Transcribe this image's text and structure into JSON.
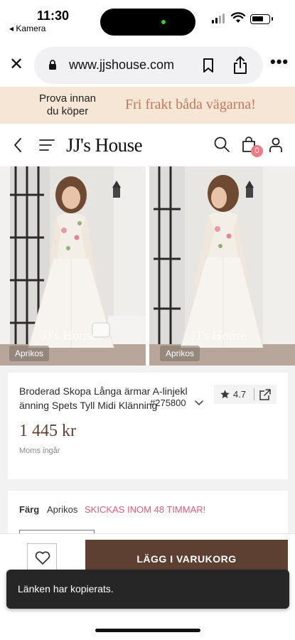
{
  "status_bar": {
    "time": "11:30",
    "back_app": "◂ Kamera"
  },
  "browser": {
    "url": "www.jjshouse.com",
    "close_icon": "close-icon",
    "more_icon": "more-icon"
  },
  "promo": {
    "left_text": "Prova innan du köper",
    "right_text": "Fri frakt båda vägarna!",
    "background": "#f6e6d5",
    "accent": "#c0785b"
  },
  "header": {
    "logo": "JJ's House",
    "cart_count": "0",
    "badge_color": "#f07a82"
  },
  "gallery": {
    "images": [
      {
        "watermark": "JJ's House",
        "color_tag": "Aprikos"
      },
      {
        "watermark": "JJ's House",
        "color_tag": "Aprikos"
      }
    ]
  },
  "product": {
    "title_line1": "Broderad Skopa Långa ärmar A-linjekl",
    "title_line2": "änning Spets Tyll Midi Klänning",
    "sku": "#275800",
    "rating": "4.7",
    "price": "1 445 kr",
    "vat_note": "Moms ingår",
    "price_color": "#5c4233"
  },
  "color_section": {
    "label": "Färg",
    "value": "Aprikos",
    "shipping": "SKICKAS INOM 48 TIMMAR!",
    "shipping_color": "#e25a72"
  },
  "actions": {
    "add_to_cart": "LÄGG I VARUKORG",
    "button_color": "#5d4032"
  },
  "toast": {
    "message": "Länken har kopierats."
  }
}
